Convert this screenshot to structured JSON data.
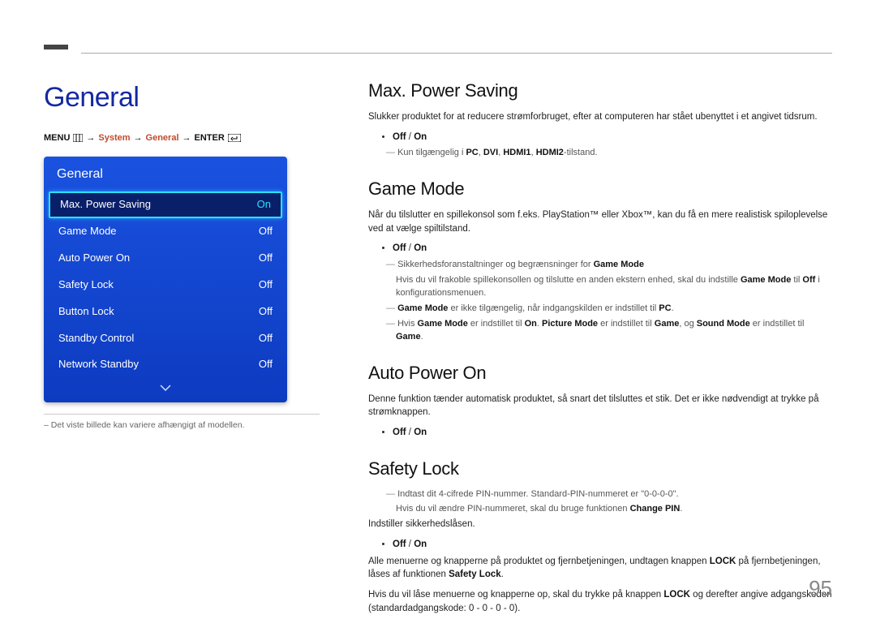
{
  "page_number": "95",
  "section_title": "General",
  "breadcrumb": {
    "prefix": "MENU",
    "arrow": "→",
    "parts": [
      "System",
      "General"
    ],
    "suffix": "ENTER"
  },
  "osd": {
    "title": "General",
    "rows": [
      {
        "label": "Max. Power Saving",
        "value": "On",
        "selected": true
      },
      {
        "label": "Game Mode",
        "value": "Off"
      },
      {
        "label": "Auto Power On",
        "value": "Off"
      },
      {
        "label": "Safety Lock",
        "value": "Off"
      },
      {
        "label": "Button Lock",
        "value": "Off"
      },
      {
        "label": "Standby Control",
        "value": "Off"
      },
      {
        "label": "Network Standby",
        "value": "Off"
      }
    ]
  },
  "left_footnote": "Det viste billede kan variere afhængigt af modellen.",
  "sections": {
    "max_power": {
      "title": "Max. Power Saving",
      "desc": "Slukker produktet for at reducere strømforbruget, efter at computeren har stået ubenyttet i et angivet tidsrum.",
      "bullet_off": "Off",
      "bullet_on": "On",
      "note_prefix": "Kun tilgængelig i ",
      "note_pc": "PC",
      "note_dvi": "DVI",
      "note_h1": "HDMI1",
      "note_h2": "HDMI2",
      "note_suffix": "-tilstand."
    },
    "game_mode": {
      "title": "Game Mode",
      "desc": "Når du tilslutter en spillekonsol som f.eks. PlayStation™ eller Xbox™, kan du få en mere realistisk spiloplevelse ved at vælge spiltilstand.",
      "bullet_off": "Off",
      "bullet_on": "On",
      "note1_prefix": "Sikkerhedsforanstaltninger og begrænsninger for ",
      "note1_gm": "Game Mode",
      "note1_sub_a": "Hvis du vil frakoble spillekonsollen og tilslutte en anden ekstern enhed, skal du indstille ",
      "note1_sub_gm": "Game Mode",
      "note1_sub_b": " til ",
      "note1_sub_off": "Off",
      "note1_sub_c": " i konfigurationsmenuen.",
      "note2_gm": "Game Mode",
      "note2_text": " er ikke tilgængelig, når indgangskilden er indstillet til ",
      "note2_pc": "PC",
      "note2_end": ".",
      "note3_a": "Hvis ",
      "note3_gm": "Game Mode",
      "note3_b": " er indstillet til ",
      "note3_on": "On",
      "note3_c": ". ",
      "note3_pm": "Picture Mode",
      "note3_d": " er indstillet til ",
      "note3_game1": "Game",
      "note3_e": ", og ",
      "note3_sm": "Sound Mode",
      "note3_f": " er indstillet til ",
      "note3_game2": "Game",
      "note3_g": "."
    },
    "auto_power": {
      "title": "Auto Power On",
      "desc": "Denne funktion tænder automatisk produktet, så snart det tilsluttes et stik. Det er ikke nødvendigt at trykke på strømknappen.",
      "bullet_off": "Off",
      "bullet_on": "On"
    },
    "safety_lock": {
      "title": "Safety Lock",
      "note1": "Indtast dit 4-cifrede PIN-nummer. Standard-PIN-nummeret er \"0-0-0-0\".",
      "note1_sub_a": "Hvis du vil ændre PIN-nummeret, skal du bruge funktionen ",
      "note1_sub_cp": "Change PIN",
      "note1_sub_b": ".",
      "desc": "Indstiller sikkerhedslåsen.",
      "bullet_off": "Off",
      "bullet_on": "On",
      "p2_a": "Alle menuerne og knapperne på produktet og fjernbetjeningen, undtagen knappen ",
      "p2_lock": "LOCK",
      "p2_b": " på fjernbetjeningen, låses af funktionen ",
      "p2_sl": "Safety Lock",
      "p2_c": ".",
      "p3_a": "Hvis du vil låse menuerne og knapperne op, skal du trykke på knappen ",
      "p3_lock": "LOCK",
      "p3_b": " og derefter angive adgangskoden (standardadgangskode: 0 - 0 - 0 - 0)."
    }
  }
}
